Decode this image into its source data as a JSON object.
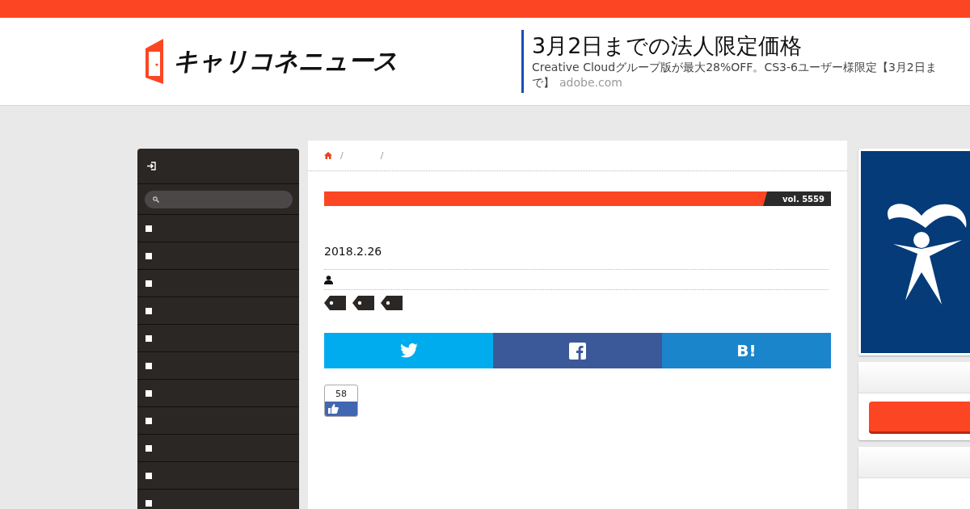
{
  "header": {
    "logo": "キャリコネニュース",
    "ad": {
      "title": "3月2日までの法人限定価格",
      "description": "Creative Cloudグループ版が最大28%OFF。CS3-6ユーザー様限定【3月2日まで】",
      "domain": "adobe.com"
    }
  },
  "sidebar": {
    "menu_items": [
      {
        "kind": "bullet"
      },
      {
        "kind": "bullet"
      },
      {
        "kind": "bullet"
      },
      {
        "kind": "bullet"
      },
      {
        "kind": "bullet"
      },
      {
        "kind": "bullet"
      },
      {
        "kind": "bullet"
      },
      {
        "kind": "bullet"
      },
      {
        "kind": "bullet"
      },
      {
        "kind": "bullet"
      },
      {
        "kind": "bullet"
      }
    ]
  },
  "article": {
    "breadcrumb_separators": [
      "/",
      "/"
    ],
    "volume": "vol. 5559",
    "date": "2018.2.26",
    "tags": [
      {
        "kind": "tag"
      },
      {
        "kind": "tag"
      },
      {
        "kind": "tag"
      }
    ],
    "share_buttons": [
      {
        "kind": "twitter"
      },
      {
        "kind": "facebook"
      },
      {
        "kind": "hatena",
        "label": "B!"
      }
    ],
    "like_count": "58"
  }
}
